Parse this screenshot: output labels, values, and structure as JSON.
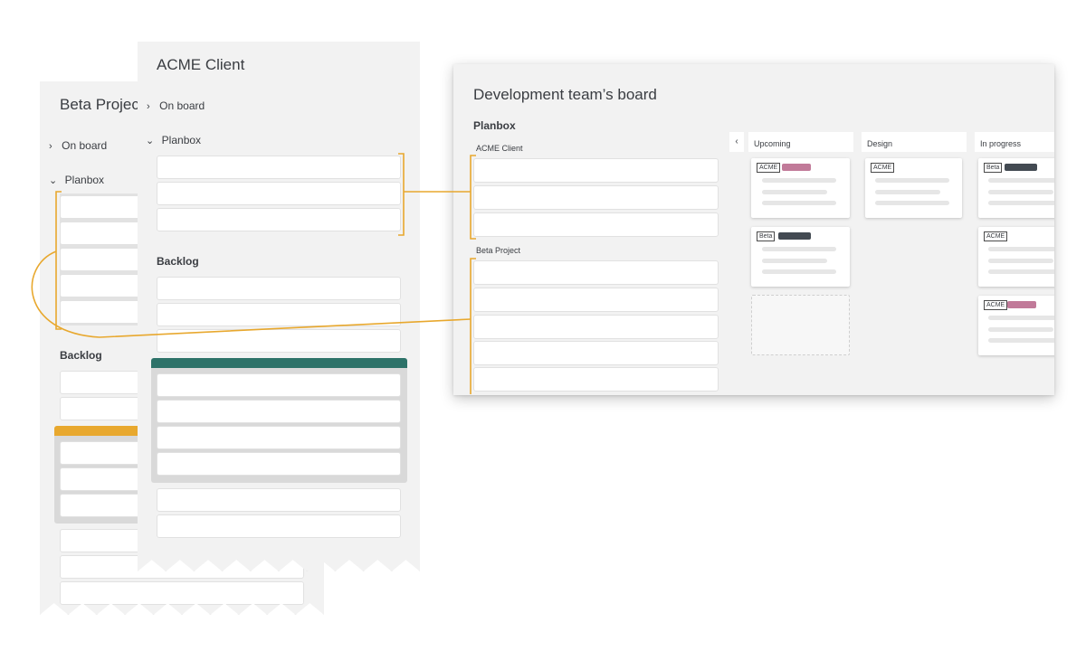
{
  "beta_panel": {
    "title": "Beta Project",
    "on_board": "On board",
    "planbox": "Planbox",
    "backlog": "Backlog",
    "group_color": "#e8a82e"
  },
  "acme_panel": {
    "title": "ACME Client",
    "on_board": "On board",
    "planbox": "Planbox",
    "backlog": "Backlog",
    "group_color": "#2d7269"
  },
  "board": {
    "title": "Development team’s board",
    "planbox": "Planbox",
    "sources": [
      "ACME Client",
      "Beta Project"
    ],
    "collapse": "‹",
    "columns": [
      "Upcoming",
      "Design",
      "In progress"
    ],
    "tags": {
      "acme": "ACME",
      "beta": "Beta"
    }
  },
  "colors": {
    "connector": "#e8a82e",
    "pill_pink": "#c17a99",
    "pill_dark": "#434a52"
  },
  "icons": {
    "expand": "chevron-right-icon",
    "collapse": "chevron-down-icon"
  }
}
